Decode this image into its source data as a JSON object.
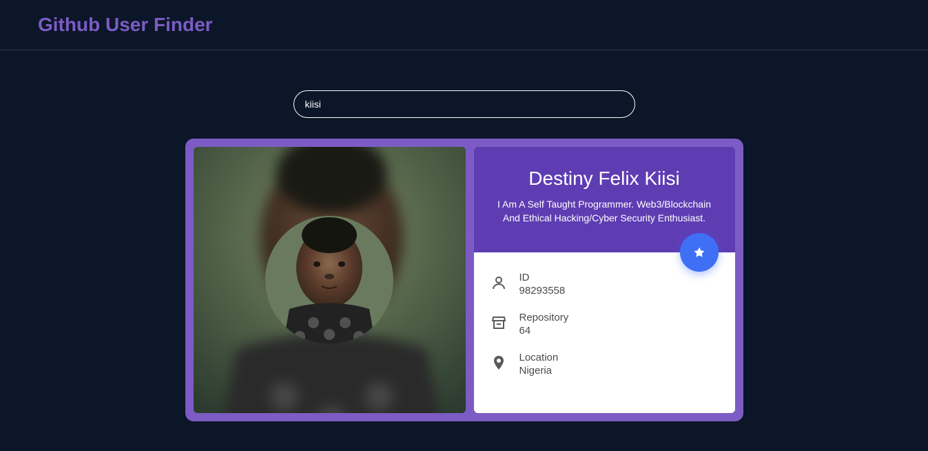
{
  "header": {
    "title": "Github User Finder"
  },
  "search": {
    "value": "kiisi",
    "placeholder": ""
  },
  "user": {
    "name": "Destiny Felix Kiisi",
    "bio": "I Am A Self Taught Programmer. Web3/Blockchain And Ethical Hacking/Cyber Security Enthusiast.",
    "details": {
      "id": {
        "label": "ID",
        "value": "98293558"
      },
      "repository": {
        "label": "Repository",
        "value": "64"
      },
      "location": {
        "label": "Location",
        "value": "Nigeria"
      }
    }
  }
}
